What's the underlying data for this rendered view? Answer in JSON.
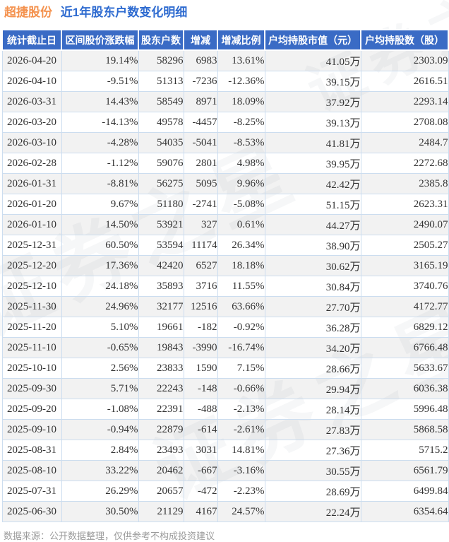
{
  "title": {
    "stock": "超捷股份",
    "text": "近1年股东户数变化明细"
  },
  "watermark": {
    "text": "证券之星"
  },
  "footer": {
    "text": "数据来源：公开数据整理，仅供参考不构成投资建议"
  },
  "colors": {
    "title_stock_orange": "#f4924e",
    "title_blue": "#2e6bd0",
    "header_bg_blue": "#3a6bc5",
    "up_red": "#e23434",
    "down_green": "#23a451",
    "grid_border": "#ccddef",
    "stripe_gray": "#f2f2f2",
    "body_text": "#333333",
    "footer_gray": "#9b9b9b"
  },
  "table": {
    "columns": [
      {
        "key": "date",
        "label": "统计截止日",
        "colored": false
      },
      {
        "key": "range-chg",
        "label": "区间股价涨跌幅",
        "colored": true
      },
      {
        "key": "holders",
        "label": "股东户数",
        "colored": false
      },
      {
        "key": "change",
        "label": "增减",
        "colored": true
      },
      {
        "key": "change-pct",
        "label": "增减比例",
        "colored": true
      },
      {
        "key": "avg-mv",
        "label": "户均持股市值（元）",
        "colored": false
      },
      {
        "key": "avg-shares",
        "label": "户均持股数（股）",
        "colored": false
      }
    ]
  },
  "chart_data": {
    "type": "table",
    "title": "超捷股份 近1年股东户数变化明细",
    "columns": [
      "统计截止日",
      "区间股价涨跌幅",
      "股东户数",
      "增减",
      "增减比例",
      "户均持股市值（元）",
      "户均持股数（股）"
    ],
    "rows": [
      [
        "2026-04-20",
        "19.14%",
        "58296",
        "6983",
        "13.61%",
        "41.05万",
        "2303.09"
      ],
      [
        "2026-04-10",
        "-9.51%",
        "51313",
        "-7236",
        "-12.36%",
        "39.15万",
        "2616.51"
      ],
      [
        "2026-03-31",
        "14.43%",
        "58549",
        "8971",
        "18.09%",
        "37.92万",
        "2293.14"
      ],
      [
        "2026-03-20",
        "-14.13%",
        "49578",
        "-4457",
        "-8.25%",
        "39.13万",
        "2708.08"
      ],
      [
        "2026-03-10",
        "-4.28%",
        "54035",
        "-5041",
        "-8.53%",
        "41.81万",
        "2484.7"
      ],
      [
        "2026-02-28",
        "-1.12%",
        "59076",
        "2801",
        "4.98%",
        "39.95万",
        "2272.68"
      ],
      [
        "2026-01-31",
        "-8.81%",
        "56275",
        "5095",
        "9.96%",
        "42.42万",
        "2385.8"
      ],
      [
        "2026-01-20",
        "9.67%",
        "51180",
        "-2741",
        "-5.08%",
        "51.15万",
        "2623.31"
      ],
      [
        "2026-01-10",
        "14.50%",
        "53921",
        "327",
        "0.61%",
        "44.27万",
        "2490.07"
      ],
      [
        "2025-12-31",
        "60.50%",
        "53594",
        "11174",
        "26.34%",
        "38.90万",
        "2505.27"
      ],
      [
        "2025-12-20",
        "17.36%",
        "42420",
        "6527",
        "18.18%",
        "30.62万",
        "3165.19"
      ],
      [
        "2025-12-10",
        "24.18%",
        "35893",
        "3716",
        "11.55%",
        "30.84万",
        "3740.76"
      ],
      [
        "2025-11-30",
        "24.96%",
        "32177",
        "12516",
        "63.66%",
        "27.70万",
        "4172.77"
      ],
      [
        "2025-11-20",
        "5.10%",
        "19661",
        "-182",
        "-0.92%",
        "36.28万",
        "6829.12"
      ],
      [
        "2025-11-10",
        "-0.65%",
        "19843",
        "-3990",
        "-16.74%",
        "34.20万",
        "6766.48"
      ],
      [
        "2025-10-10",
        "2.56%",
        "23833",
        "1590",
        "7.15%",
        "28.66万",
        "5633.67"
      ],
      [
        "2025-09-30",
        "5.71%",
        "22243",
        "-148",
        "-0.66%",
        "29.94万",
        "6036.38"
      ],
      [
        "2025-09-20",
        "-1.08%",
        "22391",
        "-488",
        "-2.13%",
        "28.14万",
        "5996.48"
      ],
      [
        "2025-09-10",
        "-0.94%",
        "22879",
        "-614",
        "-2.61%",
        "27.83万",
        "5868.58"
      ],
      [
        "2025-08-31",
        "2.84%",
        "23493",
        "3031",
        "14.81%",
        "27.36万",
        "5715.2"
      ],
      [
        "2025-08-10",
        "33.22%",
        "20462",
        "-667",
        "-3.16%",
        "30.55万",
        "6561.79"
      ],
      [
        "2025-07-31",
        "26.29%",
        "20657",
        "-472",
        "-2.23%",
        "28.69万",
        "6499.84"
      ],
      [
        "2025-06-30",
        "30.50%",
        "21129",
        "4167",
        "24.57%",
        "22.24万",
        "6354.64"
      ]
    ]
  }
}
